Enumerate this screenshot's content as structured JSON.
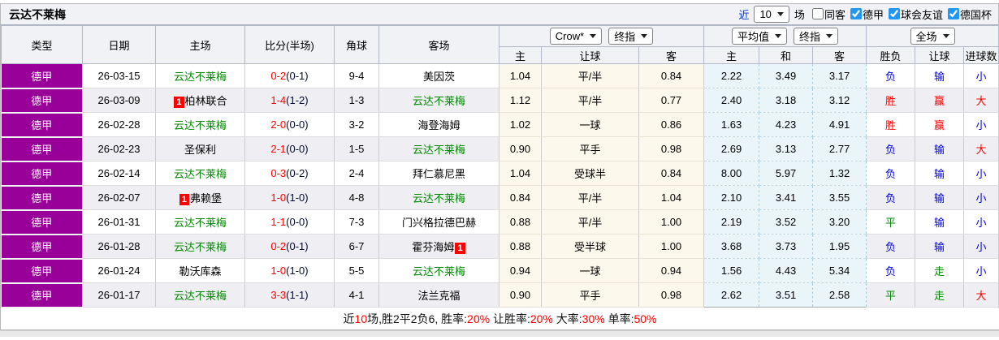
{
  "title": "云达不莱梅",
  "topbar": {
    "near_label": "近",
    "match_count": "10",
    "games_label": "场",
    "filters": [
      {
        "label": "同客",
        "checked": false
      },
      {
        "label": "德甲",
        "checked": true
      },
      {
        "label": "球会友谊",
        "checked": true
      },
      {
        "label": "德国杯",
        "checked": true
      }
    ]
  },
  "selects": {
    "bookmaker": "Crow*",
    "bookmaker_stage": "终指",
    "average": "平均值",
    "average_stage": "终指",
    "scope": "全场"
  },
  "headers": {
    "type": "类型",
    "date": "日期",
    "home": "主场",
    "score": "比分(半场)",
    "corner": "角球",
    "away": "客场",
    "odds_home": "主",
    "odds_line": "让球",
    "odds_away": "客",
    "avg_home": "主",
    "avg_draw": "和",
    "avg_away": "客",
    "res_outcome": "胜负",
    "res_handicap": "让球",
    "res_goals": "进球数"
  },
  "rows": [
    {
      "league": "德甲",
      "date": "26-03-15",
      "home": {
        "name": "云达不莱梅",
        "self": true
      },
      "score": {
        "ft": "0-2",
        "ht": "(0-1)"
      },
      "corner": "9-4",
      "away": {
        "name": "美因茨",
        "self": false
      },
      "odds": [
        "1.04",
        "平/半",
        "0.84"
      ],
      "avg": [
        "2.22",
        "3.49",
        "3.17"
      ],
      "results": [
        {
          "t": "负",
          "c": "blue"
        },
        {
          "t": "输",
          "c": "blue"
        },
        {
          "t": "小",
          "c": "blue"
        }
      ]
    },
    {
      "league": "德甲",
      "date": "26-03-09",
      "home": {
        "name": "柏林联合",
        "self": false,
        "badge": "1",
        "badge_pos": "before"
      },
      "score": {
        "ft": "1-4",
        "ht": "(1-2)"
      },
      "corner": "1-3",
      "away": {
        "name": "云达不莱梅",
        "self": true
      },
      "odds": [
        "1.12",
        "平/半",
        "0.77"
      ],
      "avg": [
        "2.40",
        "3.18",
        "3.12"
      ],
      "results": [
        {
          "t": "胜",
          "c": "red"
        },
        {
          "t": "赢",
          "c": "red"
        },
        {
          "t": "大",
          "c": "red"
        }
      ]
    },
    {
      "league": "德甲",
      "date": "26-02-28",
      "home": {
        "name": "云达不莱梅",
        "self": true
      },
      "score": {
        "ft": "2-0",
        "ht": "(0-0)"
      },
      "corner": "3-2",
      "away": {
        "name": "海登海姆",
        "self": false
      },
      "odds": [
        "1.02",
        "一球",
        "0.86"
      ],
      "avg": [
        "1.63",
        "4.23",
        "4.91"
      ],
      "results": [
        {
          "t": "胜",
          "c": "red"
        },
        {
          "t": "赢",
          "c": "red"
        },
        {
          "t": "小",
          "c": "blue"
        }
      ]
    },
    {
      "league": "德甲",
      "date": "26-02-23",
      "home": {
        "name": "圣保利",
        "self": false
      },
      "score": {
        "ft": "2-1",
        "ht": "(0-0)"
      },
      "corner": "1-5",
      "away": {
        "name": "云达不莱梅",
        "self": true
      },
      "odds": [
        "0.90",
        "平手",
        "0.98"
      ],
      "avg": [
        "2.69",
        "3.13",
        "2.77"
      ],
      "results": [
        {
          "t": "负",
          "c": "blue"
        },
        {
          "t": "输",
          "c": "blue"
        },
        {
          "t": "大",
          "c": "red"
        }
      ]
    },
    {
      "league": "德甲",
      "date": "26-02-14",
      "home": {
        "name": "云达不莱梅",
        "self": true
      },
      "score": {
        "ft": "0-3",
        "ht": "(0-2)"
      },
      "corner": "2-4",
      "away": {
        "name": "拜仁慕尼黑",
        "self": false
      },
      "odds": [
        "1.04",
        "受球半",
        "0.84"
      ],
      "avg": [
        "8.00",
        "5.97",
        "1.32"
      ],
      "results": [
        {
          "t": "负",
          "c": "blue"
        },
        {
          "t": "输",
          "c": "blue"
        },
        {
          "t": "小",
          "c": "blue"
        }
      ]
    },
    {
      "league": "德甲",
      "date": "26-02-07",
      "home": {
        "name": "弗赖堡",
        "self": false,
        "badge": "1",
        "badge_pos": "before"
      },
      "score": {
        "ft": "1-0",
        "ht": "(1-0)"
      },
      "corner": "4-8",
      "away": {
        "name": "云达不莱梅",
        "self": true
      },
      "odds": [
        "0.84",
        "平/半",
        "1.04"
      ],
      "avg": [
        "2.10",
        "3.41",
        "3.55"
      ],
      "results": [
        {
          "t": "负",
          "c": "blue"
        },
        {
          "t": "输",
          "c": "blue"
        },
        {
          "t": "小",
          "c": "blue"
        }
      ]
    },
    {
      "league": "德甲",
      "date": "26-01-31",
      "home": {
        "name": "云达不莱梅",
        "self": true
      },
      "score": {
        "ft": "1-1",
        "ht": "(0-0)"
      },
      "corner": "7-3",
      "away": {
        "name": "门兴格拉德巴赫",
        "self": false
      },
      "odds": [
        "0.88",
        "平/半",
        "1.00"
      ],
      "avg": [
        "2.19",
        "3.52",
        "3.20"
      ],
      "results": [
        {
          "t": "平",
          "c": "green"
        },
        {
          "t": "输",
          "c": "blue"
        },
        {
          "t": "小",
          "c": "blue"
        }
      ]
    },
    {
      "league": "德甲",
      "date": "26-01-28",
      "home": {
        "name": "云达不莱梅",
        "self": true
      },
      "score": {
        "ft": "0-2",
        "ht": "(0-1)"
      },
      "corner": "6-7",
      "away": {
        "name": "霍芬海姆",
        "self": false,
        "badge": "1",
        "badge_pos": "after"
      },
      "odds": [
        "0.88",
        "受半球",
        "1.00"
      ],
      "avg": [
        "3.68",
        "3.73",
        "1.95"
      ],
      "results": [
        {
          "t": "负",
          "c": "blue"
        },
        {
          "t": "输",
          "c": "blue"
        },
        {
          "t": "小",
          "c": "blue"
        }
      ]
    },
    {
      "league": "德甲",
      "date": "26-01-24",
      "home": {
        "name": "勒沃库森",
        "self": false
      },
      "score": {
        "ft": "1-0",
        "ht": "(1-0)"
      },
      "corner": "5-5",
      "away": {
        "name": "云达不莱梅",
        "self": true
      },
      "odds": [
        "0.94",
        "一球",
        "0.94"
      ],
      "avg": [
        "1.56",
        "4.43",
        "5.34"
      ],
      "results": [
        {
          "t": "负",
          "c": "blue"
        },
        {
          "t": "走",
          "c": "green"
        },
        {
          "t": "小",
          "c": "blue"
        }
      ]
    },
    {
      "league": "德甲",
      "date": "26-01-17",
      "home": {
        "name": "云达不莱梅",
        "self": true
      },
      "score": {
        "ft": "3-3",
        "ht": "(1-1)"
      },
      "corner": "4-1",
      "away": {
        "name": "法兰克福",
        "self": false
      },
      "odds": [
        "0.90",
        "平手",
        "0.98"
      ],
      "avg": [
        "2.62",
        "3.51",
        "2.58"
      ],
      "results": [
        {
          "t": "平",
          "c": "green"
        },
        {
          "t": "走",
          "c": "green"
        },
        {
          "t": "大",
          "c": "red"
        }
      ]
    }
  ],
  "footer": {
    "segments": [
      {
        "text": "近",
        "color": "black"
      },
      {
        "text": "10",
        "color": "red"
      },
      {
        "text": "场,胜2平2负6, 胜率:",
        "color": "black"
      },
      {
        "text": "20%",
        "color": "red"
      },
      {
        "text": " 让胜率:",
        "color": "black"
      },
      {
        "text": "20%",
        "color": "red"
      },
      {
        "text": " 大率:",
        "color": "black"
      },
      {
        "text": "30%",
        "color": "red"
      },
      {
        "text": " 单率:",
        "color": "black"
      },
      {
        "text": "50%",
        "color": "red"
      }
    ]
  },
  "colors": {
    "league_bg": "#990099",
    "self_team": "#008800",
    "score_fulltime": "#ff0000",
    "result_red": "#ff0000",
    "result_blue": "#0000e0",
    "result_green": "#008800",
    "odds_bg": "#fdf8ec",
    "avg_bg": "#eaf5fa",
    "checkbox_accent": "#2196f3"
  }
}
